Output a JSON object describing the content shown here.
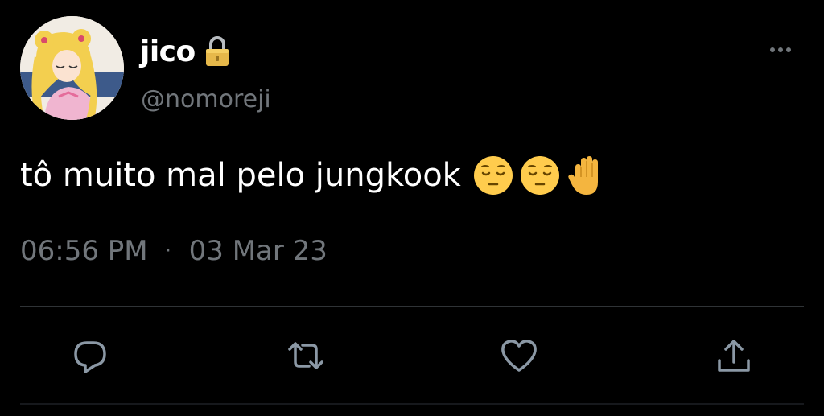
{
  "user": {
    "display_name": "jico",
    "handle": "@nomoreji",
    "protected_icon": "lock-icon",
    "avatar_icon": "avatar-anime-girl"
  },
  "tweet": {
    "text": "tô muito mal pelo jungkook",
    "emojis": [
      "pensive-face",
      "pensive-face",
      "raised-hand"
    ]
  },
  "meta": {
    "time": "06:56 PM",
    "separator": "·",
    "date": "03 Mar 23"
  },
  "actions": {
    "reply_icon": "reply-icon",
    "retweet_icon": "retweet-icon",
    "like_icon": "heart-icon",
    "share_icon": "share-icon"
  },
  "menu": {
    "more_icon": "more-icon"
  },
  "colors": {
    "background": "#000000",
    "primary_text": "#ffffff",
    "secondary_text": "#71767b",
    "divider": "#2f3336"
  }
}
